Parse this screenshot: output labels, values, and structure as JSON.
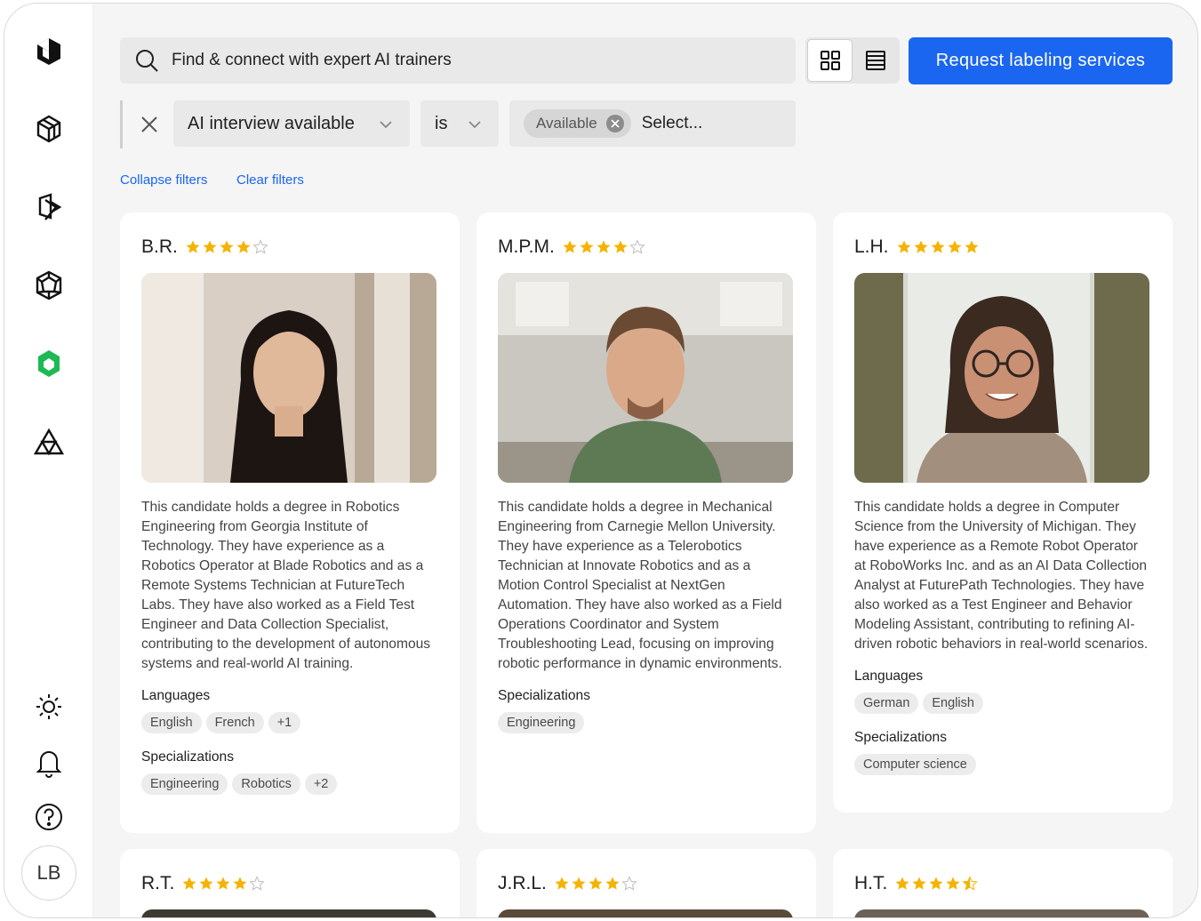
{
  "sidebar": {
    "items": [
      {
        "icon": "cube-logo-icon"
      },
      {
        "icon": "hexagon-frame-icon"
      },
      {
        "icon": "layered-shape-icon"
      },
      {
        "icon": "polyhedron-icon"
      },
      {
        "icon": "green-cluster-icon",
        "color": "#1db954"
      },
      {
        "icon": "triangle-mesh-icon"
      }
    ],
    "bottom": [
      {
        "icon": "sun-icon"
      },
      {
        "icon": "bell-icon"
      },
      {
        "icon": "help-icon"
      }
    ],
    "avatar_initials": "LB"
  },
  "header": {
    "search_placeholder": "Find & connect with expert AI trainers",
    "cta_label": "Request labeling services",
    "cta_color": "#1a66f0"
  },
  "filters": {
    "field": "AI interview available",
    "operator": "is",
    "chip": "Available",
    "select_placeholder": "Select...",
    "collapse_label": "Collapse filters",
    "clear_label": "Clear filters"
  },
  "cards": [
    {
      "name": "B.R.",
      "rating": 4,
      "bio": "This candidate holds a degree in Robotics Engineering from Georgia Institute of Technology. They have experience as a Robotics Operator at Blade Robotics and as a Remote Systems Technician at FutureTech Labs. They have also worked as a Field Test Engineer and Data Collection Specialist, contributing to the development of autonomous systems and real-world AI training.",
      "languages_title": "Languages",
      "languages": [
        "English",
        "French",
        "+1"
      ],
      "specializations_title": "Specializations",
      "specializations": [
        "Engineering",
        "Robotics",
        "+2"
      ]
    },
    {
      "name": "M.P.M.",
      "rating": 4,
      "bio": "This candidate holds a degree in Mechanical Engineering from Carnegie Mellon University. They have experience as a Telerobotics Technician at Innovate Robotics and as a Motion Control Specialist at NextGen Automation. They have also worked as a Field Operations Coordinator and System Troubleshooting Lead, focusing on improving robotic performance in dynamic environments.",
      "languages_title": "",
      "languages": [],
      "specializations_title": "Specializations",
      "specializations": [
        "Engineering"
      ]
    },
    {
      "name": "L.H.",
      "rating": 5,
      "bio": "This candidate holds a degree in Computer Science from the University of Michigan. They have experience as a Remote Robot Operator at RoboWorks Inc. and as an AI Data Collection Analyst at FuturePath Technologies. They have also worked as a Test Engineer and Behavior Modeling Assistant, contributing to refining AI-driven robotic behaviors in real-world scenarios.",
      "languages_title": "Languages",
      "languages": [
        "German",
        "English"
      ],
      "specializations_title": "Specializations",
      "specializations": [
        "Computer science"
      ]
    }
  ],
  "bottom_cards": [
    {
      "name": "R.T.",
      "rating": 4
    },
    {
      "name": "J.R.L.",
      "rating": 4
    },
    {
      "name": "H.T.",
      "rating": 4.5
    }
  ],
  "colors": {
    "star": "#f5b300",
    "star_empty": "#bdbdbd"
  }
}
